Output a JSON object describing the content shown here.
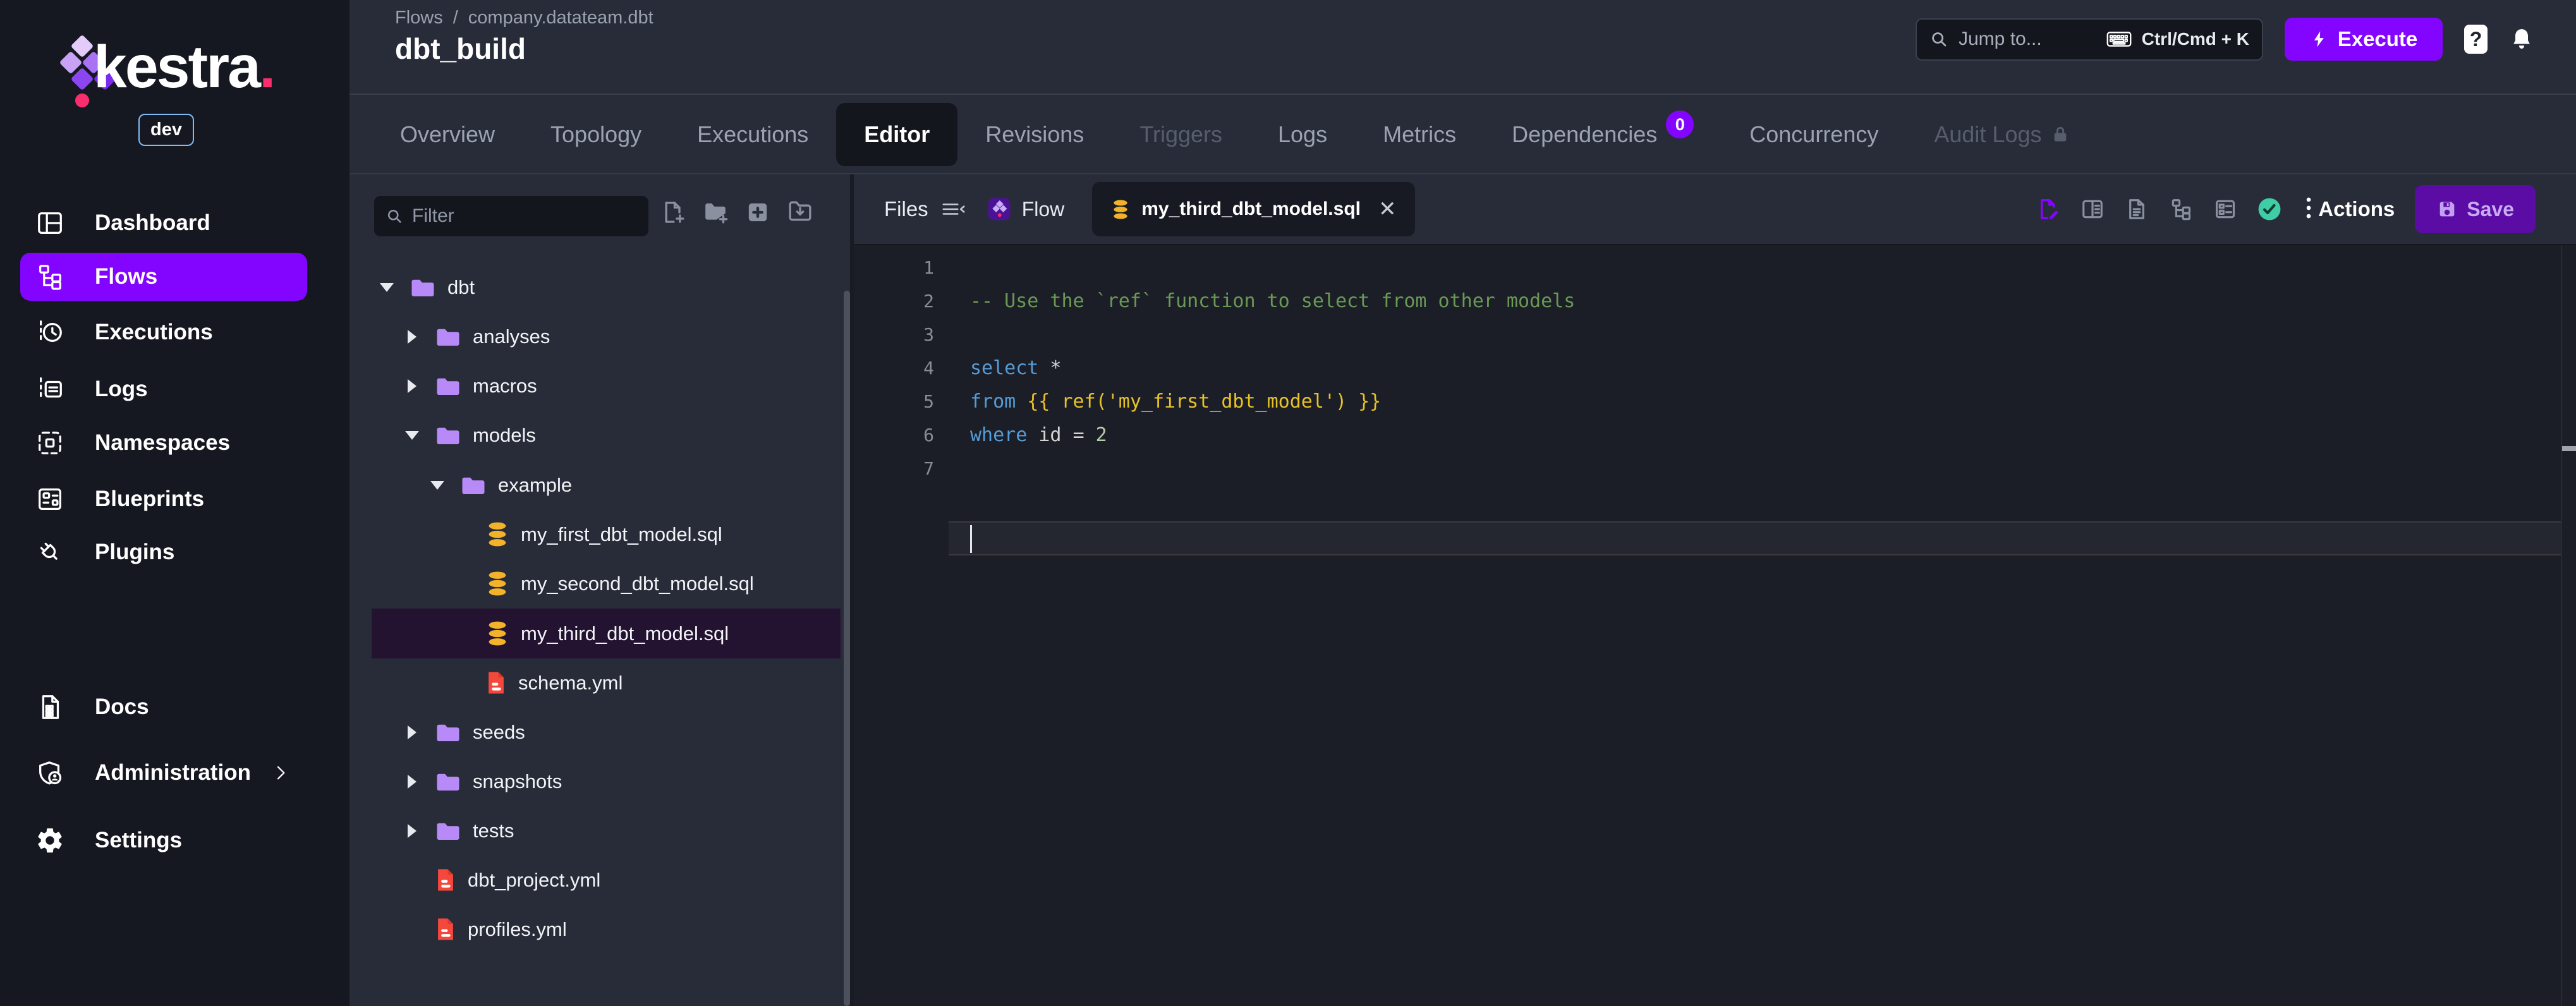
{
  "brand": {
    "wordmark": "kestra",
    "wordmark_dot": ".",
    "env_badge": "dev"
  },
  "colors": {
    "accent_purple": "#8405FF",
    "save_purple": "#5A0CA5",
    "brand_pink": "#FA2E6E",
    "folder_purple": "#B78AF7",
    "sql_gold": "#F2B32A",
    "yml_red": "#F4483C",
    "valid_green": "#3ECDA4",
    "selected_row": "#231331"
  },
  "topbar": {
    "breadcrumb": {
      "items": [
        "Flows",
        "company.datateam.dbt"
      ],
      "separator": "/"
    },
    "title": "dbt_build",
    "jump_to": {
      "placeholder": "Jump to...",
      "shortcut": "Ctrl/Cmd + K"
    },
    "execute_label": "Execute",
    "help_label": "?"
  },
  "sidebar": {
    "items": [
      {
        "label": "Dashboard",
        "icon": "dashboard-icon",
        "active": false
      },
      {
        "label": "Flows",
        "icon": "flows-icon",
        "active": true
      },
      {
        "label": "Executions",
        "icon": "executions-icon",
        "active": false
      },
      {
        "label": "Logs",
        "icon": "logs-icon",
        "active": false
      },
      {
        "label": "Namespaces",
        "icon": "namespaces-icon",
        "active": false
      },
      {
        "label": "Blueprints",
        "icon": "blueprints-icon",
        "active": false
      },
      {
        "label": "Plugins",
        "icon": "plugins-icon",
        "active": false
      },
      {
        "label": "Docs",
        "icon": "docs-icon",
        "active": false
      },
      {
        "label": "Administration",
        "icon": "administration-icon",
        "active": false,
        "has_chevron": true
      },
      {
        "label": "Settings",
        "icon": "settings-icon",
        "active": false
      }
    ]
  },
  "flow_tabs": [
    {
      "label": "Overview",
      "state": "normal"
    },
    {
      "label": "Topology",
      "state": "normal"
    },
    {
      "label": "Executions",
      "state": "normal"
    },
    {
      "label": "Editor",
      "state": "active"
    },
    {
      "label": "Revisions",
      "state": "normal"
    },
    {
      "label": "Triggers",
      "state": "disabled"
    },
    {
      "label": "Logs",
      "state": "normal"
    },
    {
      "label": "Metrics",
      "state": "normal"
    },
    {
      "label": "Dependencies",
      "state": "normal",
      "badge": "0"
    },
    {
      "label": "Concurrency",
      "state": "normal"
    },
    {
      "label": "Audit Logs",
      "state": "disabled",
      "locked": true
    }
  ],
  "file_panel": {
    "filter_placeholder": "Filter",
    "toolbar_icons": [
      "new-file",
      "new-folder",
      "add-square",
      "import-folder"
    ],
    "tree": [
      {
        "label": "dbt",
        "type": "folder",
        "level": 0,
        "expanded": true
      },
      {
        "label": "analyses",
        "type": "folder",
        "level": 1,
        "expanded": false
      },
      {
        "label": "macros",
        "type": "folder",
        "level": 1,
        "expanded": false
      },
      {
        "label": "models",
        "type": "folder",
        "level": 1,
        "expanded": true
      },
      {
        "label": "example",
        "type": "folder",
        "level": 2,
        "expanded": true
      },
      {
        "label": "my_first_dbt_model.sql",
        "type": "sql",
        "level": 3,
        "selected": false
      },
      {
        "label": "my_second_dbt_model.sql",
        "type": "sql",
        "level": 3,
        "selected": false
      },
      {
        "label": "my_third_dbt_model.sql",
        "type": "sql",
        "level": 3,
        "selected": true
      },
      {
        "label": "schema.yml",
        "type": "yml",
        "level": 3,
        "selected": false
      },
      {
        "label": "seeds",
        "type": "folder",
        "level": 1,
        "expanded": false
      },
      {
        "label": "snapshots",
        "type": "folder",
        "level": 1,
        "expanded": false
      },
      {
        "label": "tests",
        "type": "folder",
        "level": 1,
        "expanded": false
      },
      {
        "label": "dbt_project.yml",
        "type": "yml",
        "level": 1,
        "selected": false
      },
      {
        "label": "profiles.yml",
        "type": "yml",
        "level": 1,
        "selected": false
      }
    ]
  },
  "editor": {
    "files_label": "Files",
    "flow_tab_label": "Flow",
    "open_file_tab": {
      "label": "my_third_dbt_model.sql",
      "close": "✕"
    },
    "toolbar_icons": [
      "file-edit",
      "split-view",
      "file-document",
      "file-tree",
      "form-view",
      "check-circle"
    ],
    "actions_label": "Actions",
    "save_label": "Save",
    "gutter": [
      "1",
      "2",
      "3",
      "4",
      "5",
      "6",
      "7"
    ],
    "code_lines": [
      {
        "tokens": []
      },
      {
        "tokens": [
          {
            "text": "-- Use the `ref` function to select from other models",
            "style": "comment"
          }
        ]
      },
      {
        "tokens": []
      },
      {
        "tokens": [
          {
            "text": "select",
            "style": "keyword"
          },
          {
            "text": " *",
            "style": "plain"
          }
        ]
      },
      {
        "tokens": [
          {
            "text": "from",
            "style": "keyword"
          },
          {
            "text": " ",
            "style": "plain"
          },
          {
            "text": "{{ ref('my_first_dbt_model') }}",
            "style": "jinja"
          }
        ]
      },
      {
        "tokens": [
          {
            "text": "where",
            "style": "keyword"
          },
          {
            "text": " id ",
            "style": "plain"
          },
          {
            "text": "=",
            "style": "plain"
          },
          {
            "text": " 2",
            "style": "number"
          }
        ]
      },
      {
        "tokens": [],
        "cursor": true
      }
    ]
  }
}
